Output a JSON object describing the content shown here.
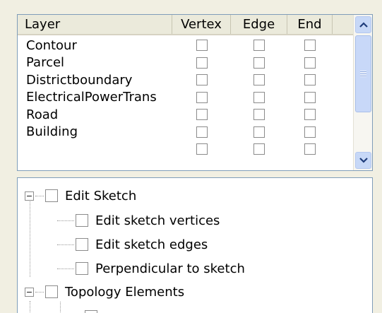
{
  "layer_table": {
    "columns": [
      "Layer",
      "Vertex",
      "Edge",
      "End"
    ],
    "rows": [
      {
        "layer": "Contour",
        "vertex": false,
        "edge": false,
        "end": false
      },
      {
        "layer": "Parcel",
        "vertex": false,
        "edge": false,
        "end": false
      },
      {
        "layer": "Districtboundary",
        "vertex": false,
        "edge": false,
        "end": false
      },
      {
        "layer": "ElectricalPowerTrans",
        "vertex": false,
        "edge": false,
        "end": false
      },
      {
        "layer": "Road",
        "vertex": false,
        "edge": false,
        "end": false
      },
      {
        "layer": "Building",
        "vertex": false,
        "edge": false,
        "end": false
      }
    ]
  },
  "tree": {
    "nodes": [
      {
        "label": "Edit Sketch",
        "expander": "−",
        "level": 0
      },
      {
        "label": "Edit sketch vertices",
        "level": 1
      },
      {
        "label": "Edit sketch edges",
        "level": 1
      },
      {
        "label": "Perpendicular to sketch",
        "level": 1
      },
      {
        "label": "Topology Elements",
        "expander": "−",
        "level": 0
      }
    ]
  },
  "icons": {
    "scroll_up": "chevron-up-icon",
    "scroll_down": "chevron-down-icon"
  }
}
